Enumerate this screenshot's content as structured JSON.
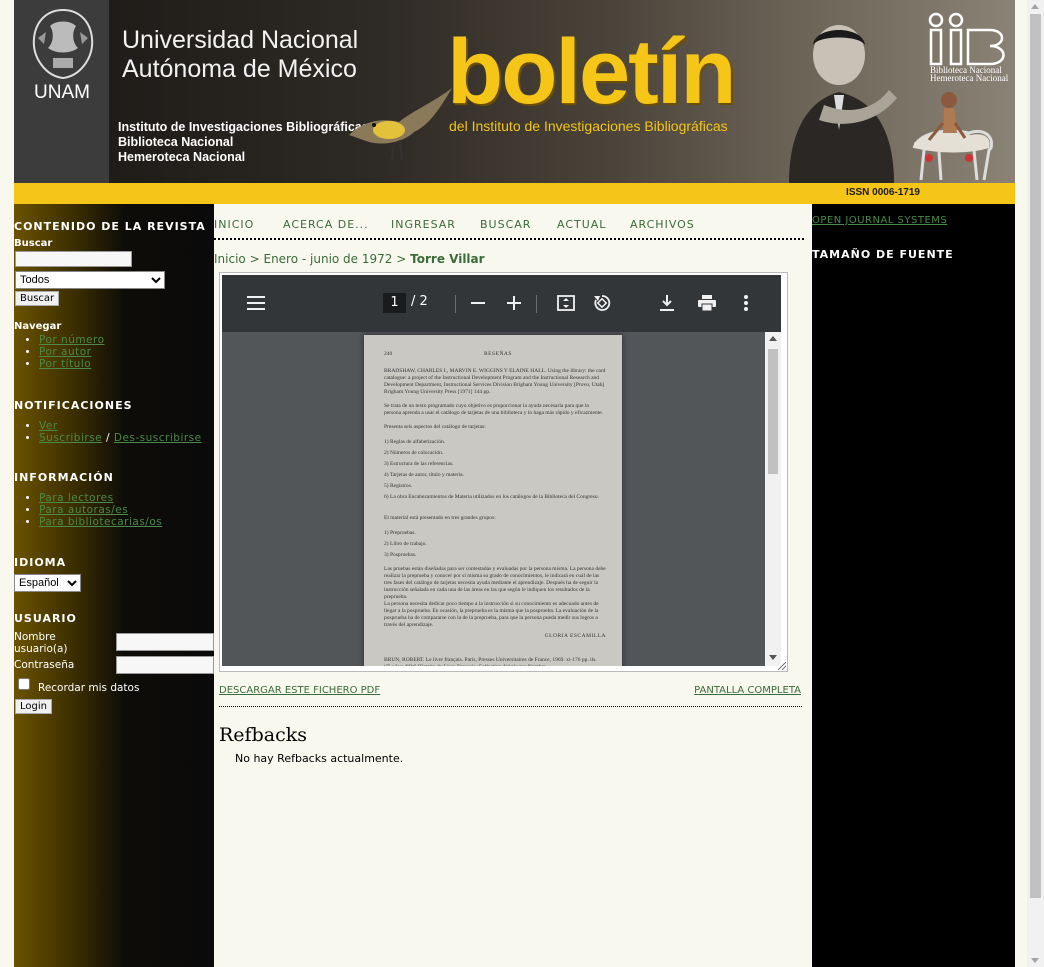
{
  "header": {
    "unam_label": "UNAM",
    "university_line1": "Universidad Nacional",
    "university_line2": "Autónoma de México",
    "institute_line1": "Instituto de Investigaciones Bibliográficas",
    "institute_line2": "Biblioteca Nacional",
    "institute_line3": "Hemeroteca Nacional",
    "journal_title": "boletín",
    "journal_subtitle": "del Instituto de Investigaciones Bibliográficas",
    "iib_line1": "Biblioteca Nacional",
    "iib_line2": "Hemeroteca Nacional",
    "issn": "ISSN 0006-1719",
    "accent_color": "#f5c518"
  },
  "left_sidebar": {
    "journal_content_title": "CONTENIDO DE LA REVISTA",
    "search_label": "Buscar",
    "search_value": "",
    "scope_selected": "Todos",
    "search_button": "Buscar",
    "browse_label": "Navegar",
    "browse_items": [
      "Por número",
      "Por autor",
      "Por título"
    ],
    "notifications_title": "NOTIFICACIONES",
    "notif_view": "Ver",
    "notif_subscribe": "Suscribirse",
    "notif_separator": "/",
    "notif_unsubscribe": "Des-suscribirse",
    "information_title": "INFORMACIÓN",
    "info_items": [
      "Para lectores",
      "Para autoras/es",
      "Para bibliotecarias/os"
    ],
    "language_title": "IDIOMA",
    "language_selected": "Español",
    "user_title": "USUARIO",
    "username_label": "Nombre usuario(a)",
    "password_label": "Contraseña",
    "remember_label": "Recordar mis datos",
    "login_button": "Login"
  },
  "nav": {
    "items": [
      "INICIO",
      "ACERCA DE...",
      "INGRESAR",
      "BUSCAR",
      "ACTUAL",
      "ARCHIVOS"
    ]
  },
  "breadcrumb": {
    "home": "Inicio",
    "issue": "Enero - junio de 1972",
    "current": "Torre Villar",
    "separator": ">"
  },
  "pdf_viewer": {
    "current_page": "1",
    "page_separator": "/",
    "total_pages": "2",
    "icons": [
      "menu-icon",
      "zoom-out-icon",
      "zoom-in-icon",
      "fit-page-icon",
      "rotate-icon",
      "download-icon",
      "print-icon",
      "more-icon"
    ],
    "page_header_left": "240",
    "page_header_center": "RESEÑAS",
    "page_paragraphs": [
      "BRADSHAW, CHARLES I., MARVIN E. WIGGINS Y ELAINE HALL. Using the library: the card catalogue: a project of the Instructional Development Program and the Instructional Research and Development Department, Instructional Services Division Brigham Young University [Provo, Utah] Brigham Young University Press [1971] 144 pp.",
      "Se trata de un texto programado cuyo objetivo es proporcionar la ayuda necesaria para que la persona aprenda a usar el catálogo de tarjetas de una biblioteca y lo haga más rápido y eficazmente.",
      "Presenta seis aspectos del catálogo de tarjetas:",
      "1) Reglas de alfabetización.",
      "2) Números de colocación.",
      "3) Estructura de las referencias.",
      "4) Tarjetas de autor, título y materia.",
      "5) Registros.",
      "6) La obra Encabezamientos de Materia utilizados en los catálogos de la Biblioteca del Congreso.",
      "El material está presentado en tres grandes grupos:",
      "1) Prepruebas.",
      "2) Libro de trabajo.",
      "3) Pospruebas.",
      "Las pruebas están diseñadas para ser contestadas y evaluadas por la persona misma. La persona debe realizar la preprueba y conocer por sí misma su grado de conocimientos, le indicará en cuál de las tres fases del catálogo de tarjetas necesita ayuda mediante el aprendizaje. Después ha de seguir la instrucción señalada en cada una de las áreas en las que según le indiquen los resultados de la preprueba.",
      "La persona necesita dedicar poco tiempo a la instrucción si su conocimiento es adecuado antes de llegar a la posprueba. En ocasión, la preprueba es la misma que la posprueba. La evaluación de la posprueba ha de compararse con la de la preprueba, para que la persona pueda medir sus logros a través del aprendizaje.",
      "GLORIA ESCAMILLA",
      "BRUN, ROBERT. Le livre français. París, Presses Universitaires de France, 1969. xi-176 pp. ils. (\"Le Lys d'Or\" Histoire du Livre Français. Collection dirigée par Nombre..."
    ]
  },
  "links": {
    "download_pdf": "DESCARGAR ESTE FICHERO PDF",
    "fullscreen": "PANTALLA COMPLETA"
  },
  "refbacks": {
    "title": "Refbacks",
    "message": "No hay Refbacks actualmente."
  },
  "right_sidebar": {
    "ojs_link": "OPEN JOURNAL SYSTEMS",
    "font_size_title": "TAMAÑO DE FUENTE"
  }
}
